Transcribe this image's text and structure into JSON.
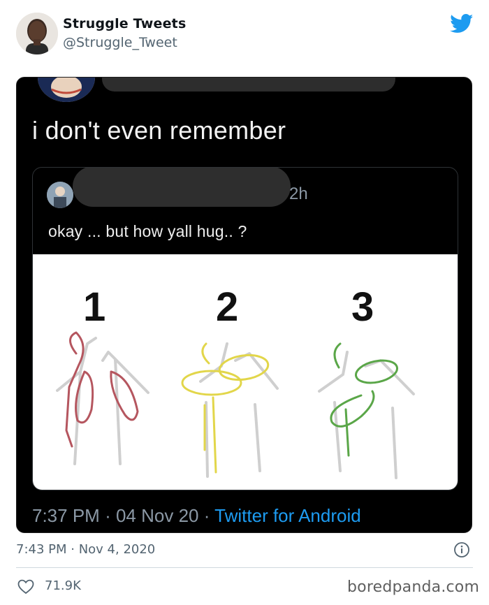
{
  "author": {
    "display_name": "Struggle Tweets",
    "handle": "@Struggle_Tweet"
  },
  "icons": {
    "brand": "twitter-bird-icon",
    "info": "info-icon",
    "like": "heart-icon"
  },
  "colors": {
    "twitter_blue": "#1d9bf0",
    "screenshot_bg": "#000000",
    "hug1_stroke": "#b5565f",
    "hug2_stroke": "#e2d64a",
    "hug3_stroke": "#5aa648"
  },
  "screenshot": {
    "reply_text": "i don't even remember",
    "quoted": {
      "time_ago": "2h",
      "text": "okay ... but how yall hug.. ?",
      "image": {
        "labels": [
          "1",
          "2",
          "3"
        ]
      }
    },
    "meta": {
      "time": "7:37 PM",
      "separator": "·",
      "date": "04 Nov 20",
      "source": "Twitter for Android"
    }
  },
  "tweet": {
    "timestamp": "7:43 PM · Nov 4, 2020",
    "likes": "71.9K"
  },
  "watermark": "boredpanda.com"
}
